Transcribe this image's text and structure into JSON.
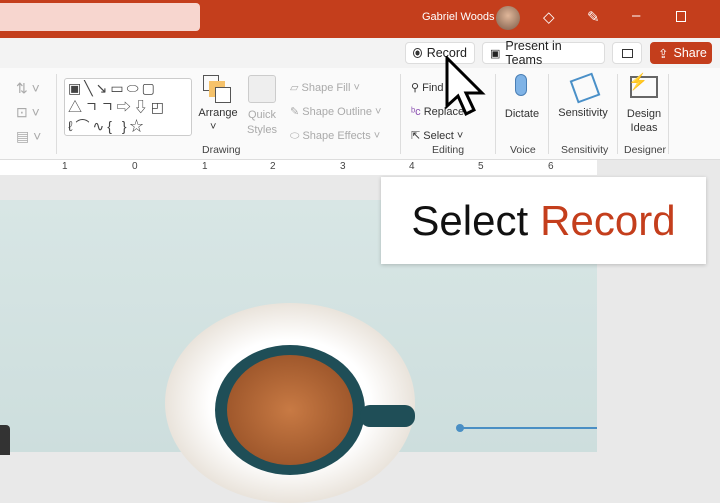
{
  "titlebar": {
    "user": "Gabriel Woods"
  },
  "cmdbar": {
    "record": "Record",
    "present": "Present in Teams",
    "share": "Share"
  },
  "ribbon": {
    "arrange": "Arrange",
    "quick_styles_1": "Quick",
    "quick_styles_2": "Styles",
    "shape_fill": "Shape Fill",
    "shape_outline": "Shape Outline",
    "shape_effects": "Shape Effects",
    "drawing": "Drawing",
    "find": "Find",
    "replace": "Replace",
    "select": "Select",
    "editing": "Editing",
    "dictate": "Dictate",
    "voice": "Voice",
    "sensitivity": "Sensitivity",
    "sensitivity_group": "Sensitivity",
    "design_1": "Design",
    "design_2": "Ideas",
    "designer": "Designer"
  },
  "ruler": [
    "1",
    "0",
    "1",
    "2",
    "3",
    "4",
    "5",
    "6"
  ],
  "callout": {
    "prefix": "Select",
    "highlight": "Record",
    "highlight_color": "#c43e1c"
  }
}
